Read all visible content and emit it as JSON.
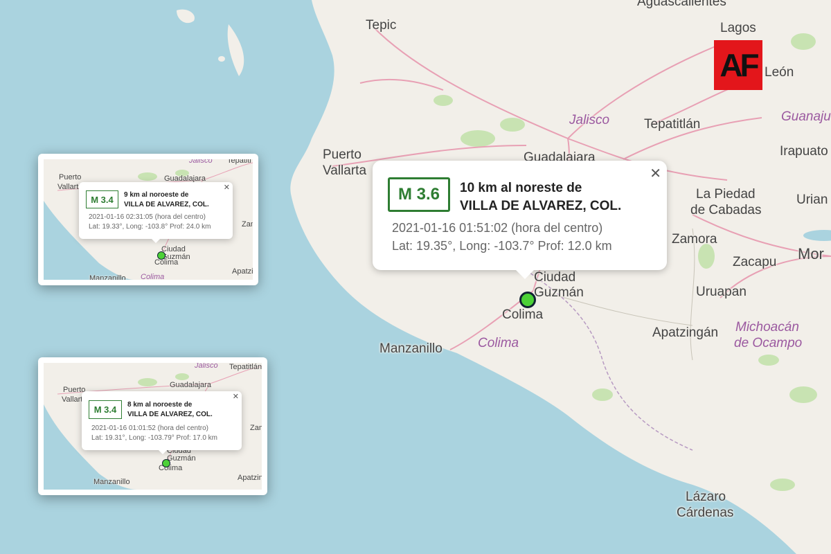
{
  "brand": {
    "logo_text": "AF",
    "logo_color": "#e3161b"
  },
  "map": {
    "labels": {
      "aguascalientes": "Aguascalientes",
      "tepic": "Tepic",
      "lagos": "Lagos",
      "leon": "León",
      "jalisco": "Jalisco",
      "guanajuato": "Guanaju",
      "tepatitlan": "Tepatitlán",
      "puerto_vallarta_1": "Puerto",
      "puerto_vallarta_2": "Vallarta",
      "guadalajara": "Guadalajara",
      "irapuato": "Irapuato",
      "la_piedad_1": "La Piedad",
      "la_piedad_2": "de Cabadas",
      "uriangato": "Urian",
      "zamora": "Zamora",
      "zacapu": "Zacapu",
      "morelia": "Mor",
      "uruapan": "Uruapan",
      "ciudad": "Ciudad",
      "guzman": "Guzmán",
      "colima_city": "Colima",
      "colima_state": "Colima",
      "manzanillo": "Manzanillo",
      "apatzingan": "Apatzingán",
      "michoacan_1": "Michoacán",
      "michoacan_2": "de Ocampo",
      "lazaro_1": "Lázaro",
      "lazaro_2": "Cárdenas"
    },
    "colors": {
      "water": "#aad3df",
      "land": "#f2efe9",
      "road": "#e8a0b4",
      "marker": "#4cd137",
      "magnitude": "#2e7d32"
    }
  },
  "main_popup": {
    "magnitude": "M 3.6",
    "title_line1": "10 km al noreste de",
    "title_line2": "VILLA DE ALVAREZ, COL.",
    "datetime": "2021-01-16   01:51:02 (hora del centro)",
    "coords": "Lat: 19.35°, Long: -103.7°   Prof: 12.0 km",
    "close": "✕"
  },
  "inset1": {
    "labels": {
      "jalisco": "Jalisco",
      "tepatitlan": "Tepatitl",
      "puerto": "Puerto",
      "vallarta": "Vallart",
      "guadalajara": "Guadalajara",
      "zam": "Zam",
      "ciudad": "Ciudad",
      "guzman": "Guzmán",
      "colima": "Colima",
      "colima_state": "Colima",
      "manzanillo": "Manzanillo",
      "apatzin": "Apatzin"
    },
    "popup": {
      "magnitude": "M 3.4",
      "title_line1": "9 km al noroeste de",
      "title_line2": "VILLA DE ALVAREZ, COL.",
      "datetime": "2021-01-16   02:31:05 (hora del centro)",
      "coords": "Lat: 19.33°, Long: -103.8°   Prof: 24.0 km",
      "close": "✕"
    }
  },
  "inset2": {
    "labels": {
      "jalisco": "Jalisco",
      "tepatitlan": "Tepatitlán",
      "puerto": "Puerto",
      "vallarta": "Vallart",
      "guadalajara": "Guadalajara",
      "zam": "Zam",
      "ciudad": "Ciudad",
      "guzman": "Guzmán",
      "colima": "Colima",
      "manzanillo": "Manzanillo",
      "apatzin": "Apatzin"
    },
    "popup": {
      "magnitude": "M 3.4",
      "title_line1": "8 km al noroeste de",
      "title_line2": "VILLA DE ALVAREZ, COL.",
      "datetime": "2021-01-16   01:01:52 (hora del centro)",
      "coords": "Lat: 19.31°, Long: -103.79°   Prof: 17.0 km",
      "close": "✕"
    }
  }
}
